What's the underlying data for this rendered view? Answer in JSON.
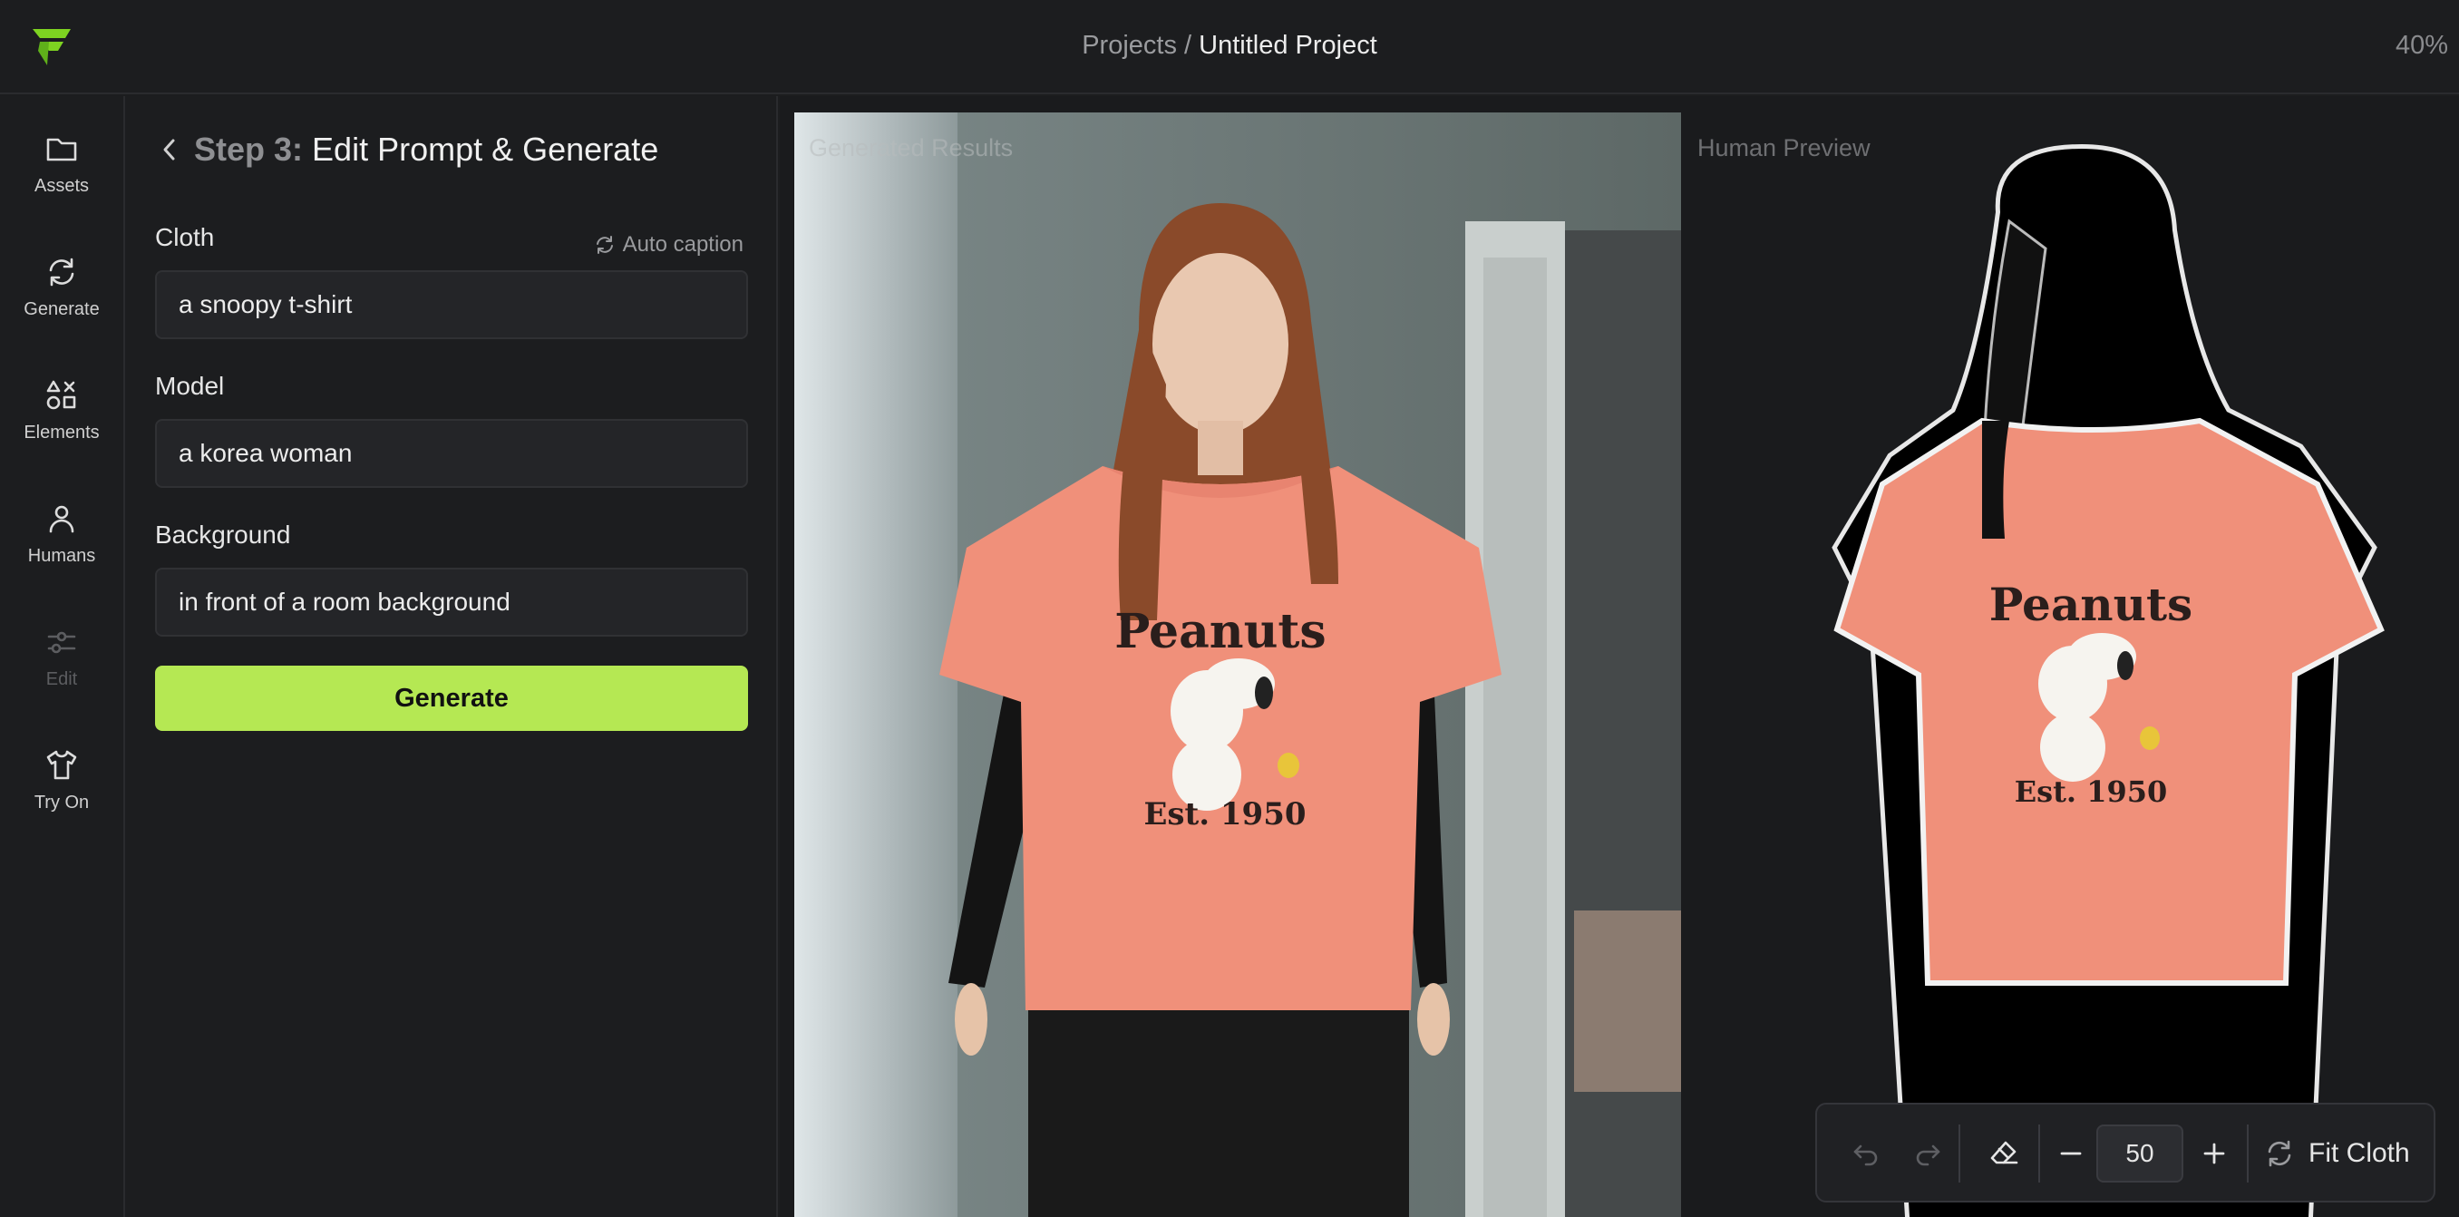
{
  "header": {
    "breadcrumb_parent": "Projects",
    "breadcrumb_sep": " / ",
    "project_name": "Untitled Project",
    "zoom": "40%",
    "logo_icon": "bolt-logo-icon",
    "accent": "#7ed321"
  },
  "sidebar": {
    "items": [
      {
        "label": "Assets",
        "icon": "folder-icon"
      },
      {
        "label": "Generate",
        "icon": "refresh-icon"
      },
      {
        "label": "Elements",
        "icon": "shapes-icon"
      },
      {
        "label": "Humans",
        "icon": "person-icon"
      },
      {
        "label": "Edit",
        "icon": "sliders-icon",
        "disabled": true
      },
      {
        "label": "Try On",
        "icon": "shirt-icon"
      }
    ]
  },
  "panel": {
    "step": "Step 3:",
    "title": "Edit Prompt & Generate",
    "cloth_label": "Cloth",
    "auto_caption": "Auto caption",
    "cloth_value": "a snoopy t-shirt",
    "model_label": "Model",
    "model_value": "a korea woman",
    "background_label": "Background",
    "background_value": "in front of a room background",
    "generate_label": "Generate",
    "generate_color": "#b5e853"
  },
  "canvas": {
    "result_label": "Generated Results",
    "preview_label": "Human Preview",
    "shirt_text_top": "Peanuts",
    "shirt_text_bottom": "Est. 1950",
    "shirt_color": "#f0907a"
  },
  "toolbar": {
    "brush_size": "50",
    "fit_label": "Fit Cloth"
  }
}
